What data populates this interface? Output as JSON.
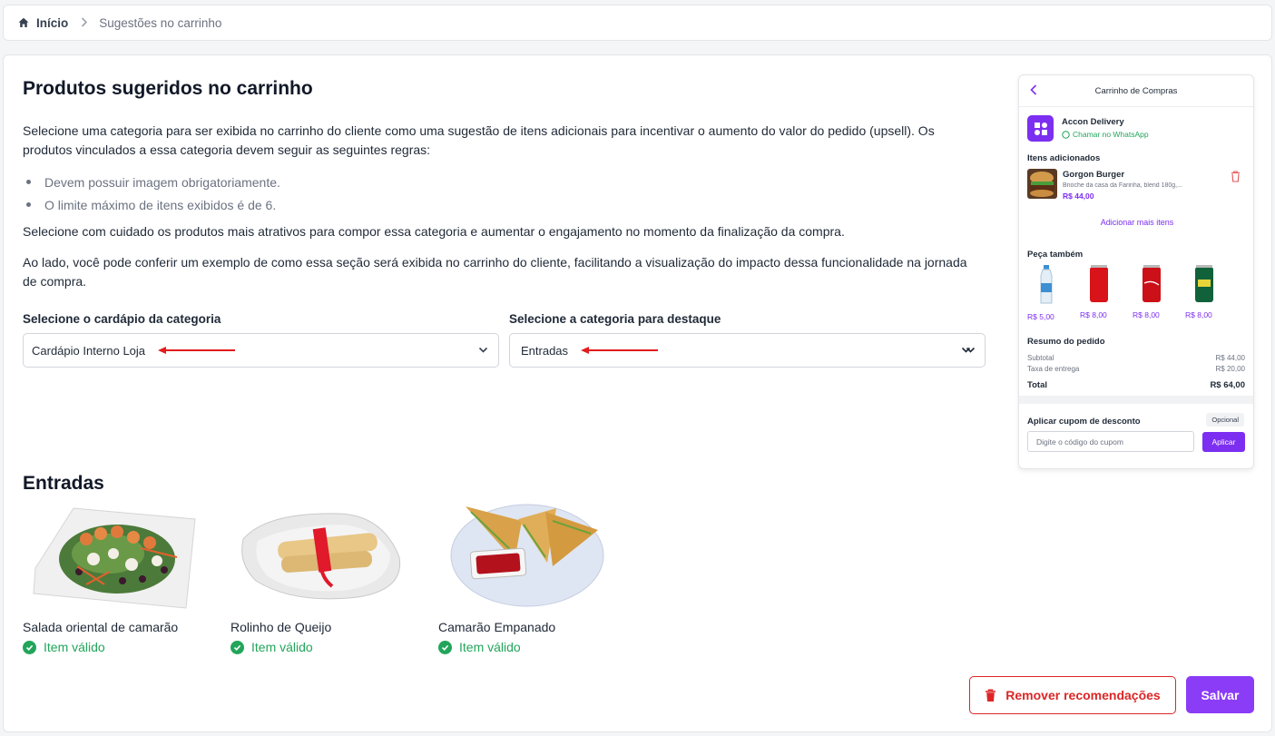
{
  "breadcrumb": {
    "home": "Início",
    "current": "Sugestões no carrinho"
  },
  "page": {
    "title": "Produtos sugeridos no carrinho",
    "intro": "Selecione uma categoria para ser exibida no carrinho do cliente como uma sugestão de itens adicionais para incentivar o aumento do valor do pedido (upsell). Os produtos vinculados a essa categoria devem seguir as seguintes regras:",
    "rules": [
      "Devem possuir imagem obrigatoriamente.",
      "O limite máximo de itens exibidos é de 6."
    ],
    "para2": "Selecione com cuidado os produtos mais atrativos para compor essa categoria e aumentar o engajamento no momento da finalização da compra.",
    "para3": "Ao lado, você pode conferir um exemplo de como essa seção será exibida no carrinho do cliente, facilitando a visualização do impacto dessa funcionalidade na jornada de compra."
  },
  "form": {
    "menu_label": "Selecione o cardápio da categoria",
    "menu_value": "Cardápio Interno Loja",
    "category_label": "Selecione a categoria para destaque",
    "category_value": "Entradas"
  },
  "section": {
    "title": "Entradas",
    "products": [
      {
        "name": "Salada oriental de camarão",
        "status": "Item válido"
      },
      {
        "name": "Rolinho de Queijo",
        "status": "Item válido"
      },
      {
        "name": "Camarão Empanado",
        "status": "Item válido"
      }
    ]
  },
  "actions": {
    "remove": "Remover recomendações",
    "save": "Salvar"
  },
  "preview": {
    "title": "Carrinho de Compras",
    "store_name": "Accon Delivery",
    "whatsapp": "Chamar no WhatsApp",
    "items_title": "Itens adicionados",
    "item": {
      "name": "Gorgon Burger",
      "desc": "Brioche da casa da Farinha, blend 180g,...",
      "price": "R$ 44,00"
    },
    "add_more": "Adicionar mais itens",
    "also_title": "Peça também",
    "suggestions": [
      "R$ 5,00",
      "R$ 8,00",
      "R$ 8,00",
      "R$ 8,00"
    ],
    "summary_title": "Resumo do pedido",
    "subtotal_label": "Subtotal",
    "subtotal_value": "R$ 44,00",
    "fee_label": "Taxa de entrega",
    "fee_value": "R$ 20,00",
    "total_label": "Total",
    "total_value": "R$ 64,00",
    "coupon_title": "Aplicar cupom de desconto",
    "optional": "Opcional",
    "coupon_placeholder": "Digite o código do cupom",
    "apply": "Aplicar"
  },
  "colors": {
    "accent": "#8b3cf7",
    "danger": "#dc2626",
    "success": "#22a55a",
    "annotation": "#e11d1d"
  }
}
